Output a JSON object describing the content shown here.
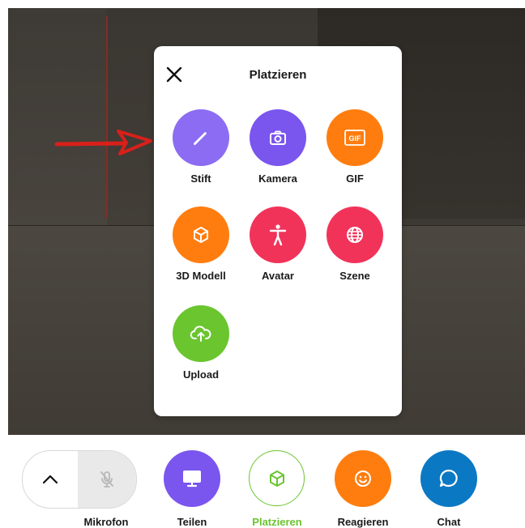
{
  "panel": {
    "title": "Platzieren",
    "items": [
      {
        "label": "Stift",
        "icon": "pencil-icon",
        "color": "#8c6cf2"
      },
      {
        "label": "Kamera",
        "icon": "camera-icon",
        "color": "#7a55ee"
      },
      {
        "label": "GIF",
        "icon": "gif-icon",
        "color": "#ff7d0f"
      },
      {
        "label": "3D Modell",
        "icon": "cube-icon",
        "color": "#ff7d0f"
      },
      {
        "label": "Avatar",
        "icon": "person-icon",
        "color": "#f1335a"
      },
      {
        "label": "Szene",
        "icon": "globe-icon",
        "color": "#f1335a"
      },
      {
        "label": "Upload",
        "icon": "cloud-upload-icon",
        "color": "#6ac52f"
      }
    ],
    "gif_badge_text": "GIF"
  },
  "toolbar": {
    "microphone_label": "Mikrofon",
    "share_label": "Teilen",
    "place_label": "Platzieren",
    "react_label": "Reagieren",
    "chat_label": "Chat",
    "colors": {
      "share": "#7a55ee",
      "place_border": "#6ac52f",
      "place_text": "#6ac52f",
      "react": "#ff7d0f",
      "chat": "#0b78c4"
    }
  },
  "annotation": {
    "arrow_color": "#d8201a"
  }
}
